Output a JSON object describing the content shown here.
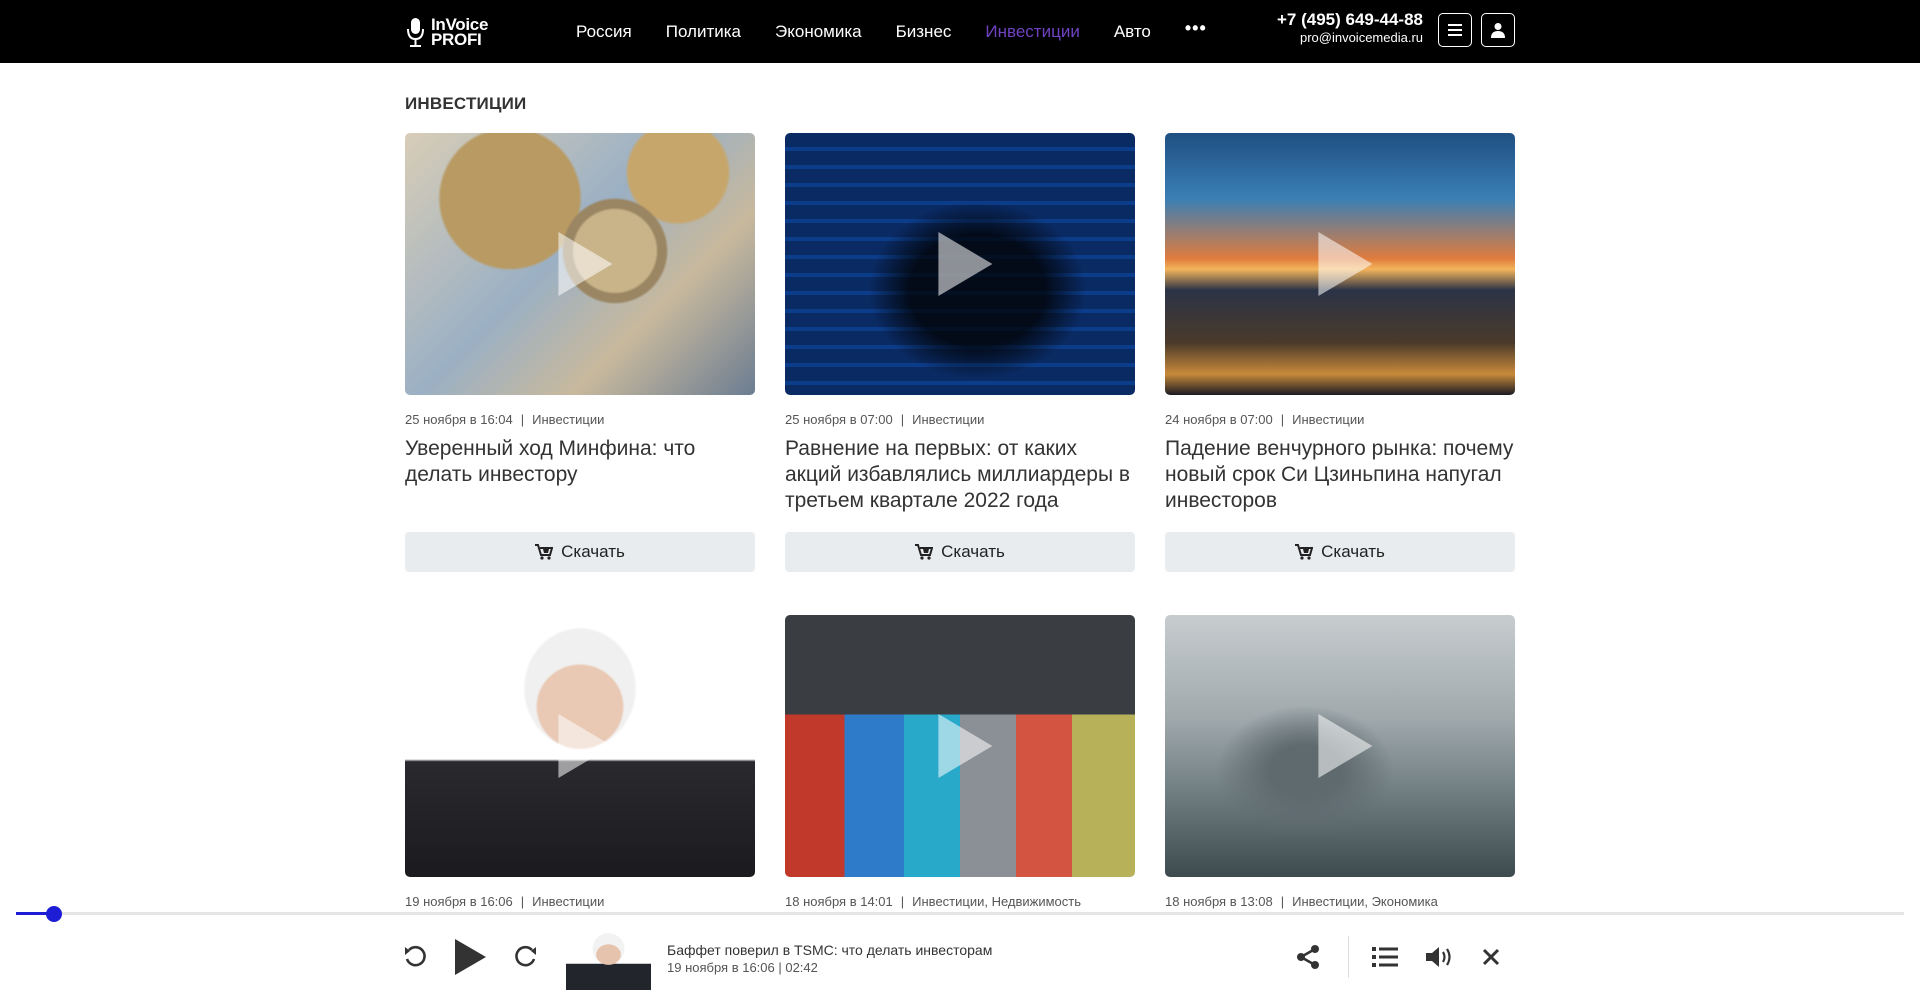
{
  "header": {
    "logo_line1": "InVoice",
    "logo_line2": "PROFI",
    "nav": [
      {
        "label": "Россия"
      },
      {
        "label": "Политика"
      },
      {
        "label": "Экономика"
      },
      {
        "label": "Бизнес"
      },
      {
        "label": "Инвестиции",
        "active": true
      },
      {
        "label": "Авто"
      }
    ],
    "more": "•••",
    "phone": "+7 (495) 649-44-88",
    "email": "pro@invoicemedia.ru",
    "menu_icon": "hamburger-icon",
    "user_icon": "user-icon"
  },
  "section": {
    "title": "ИНВЕСТИЦИИ"
  },
  "cards": [
    {
      "date": "25 ноября в 16:04",
      "tags": "Инвестиции",
      "title": "Уверенный ход Минфина: что делать инвестору",
      "download": "Скачать"
    },
    {
      "date": "25 ноября в 07:00",
      "tags": "Инвестиции",
      "title": "Равнение на первых: от каких акций избавлялись миллиардеры в третьем квартале 2022 года",
      "download": "Скачать"
    },
    {
      "date": "24 ноября в 07:00",
      "tags": "Инвестиции",
      "title": "Падение венчурного рынка: почему новый срок Си Цзиньпина напугал инвесторов",
      "download": "Скачать"
    },
    {
      "date": "19 ноября в 16:06",
      "tags": "Инвестиции"
    },
    {
      "date": "18 ноября в 14:01",
      "tags": "Инвестиции, Недвижимость"
    },
    {
      "date": "18 ноября в 13:08",
      "tags": "Инвестиции, Экономика"
    }
  ],
  "player": {
    "title": "Баффет поверил в TSMC: что делать инвесторам",
    "subtitle": "19 ноября в 16:06 | 02:42",
    "progress": 0.01,
    "accent": "#1d1dd6"
  }
}
